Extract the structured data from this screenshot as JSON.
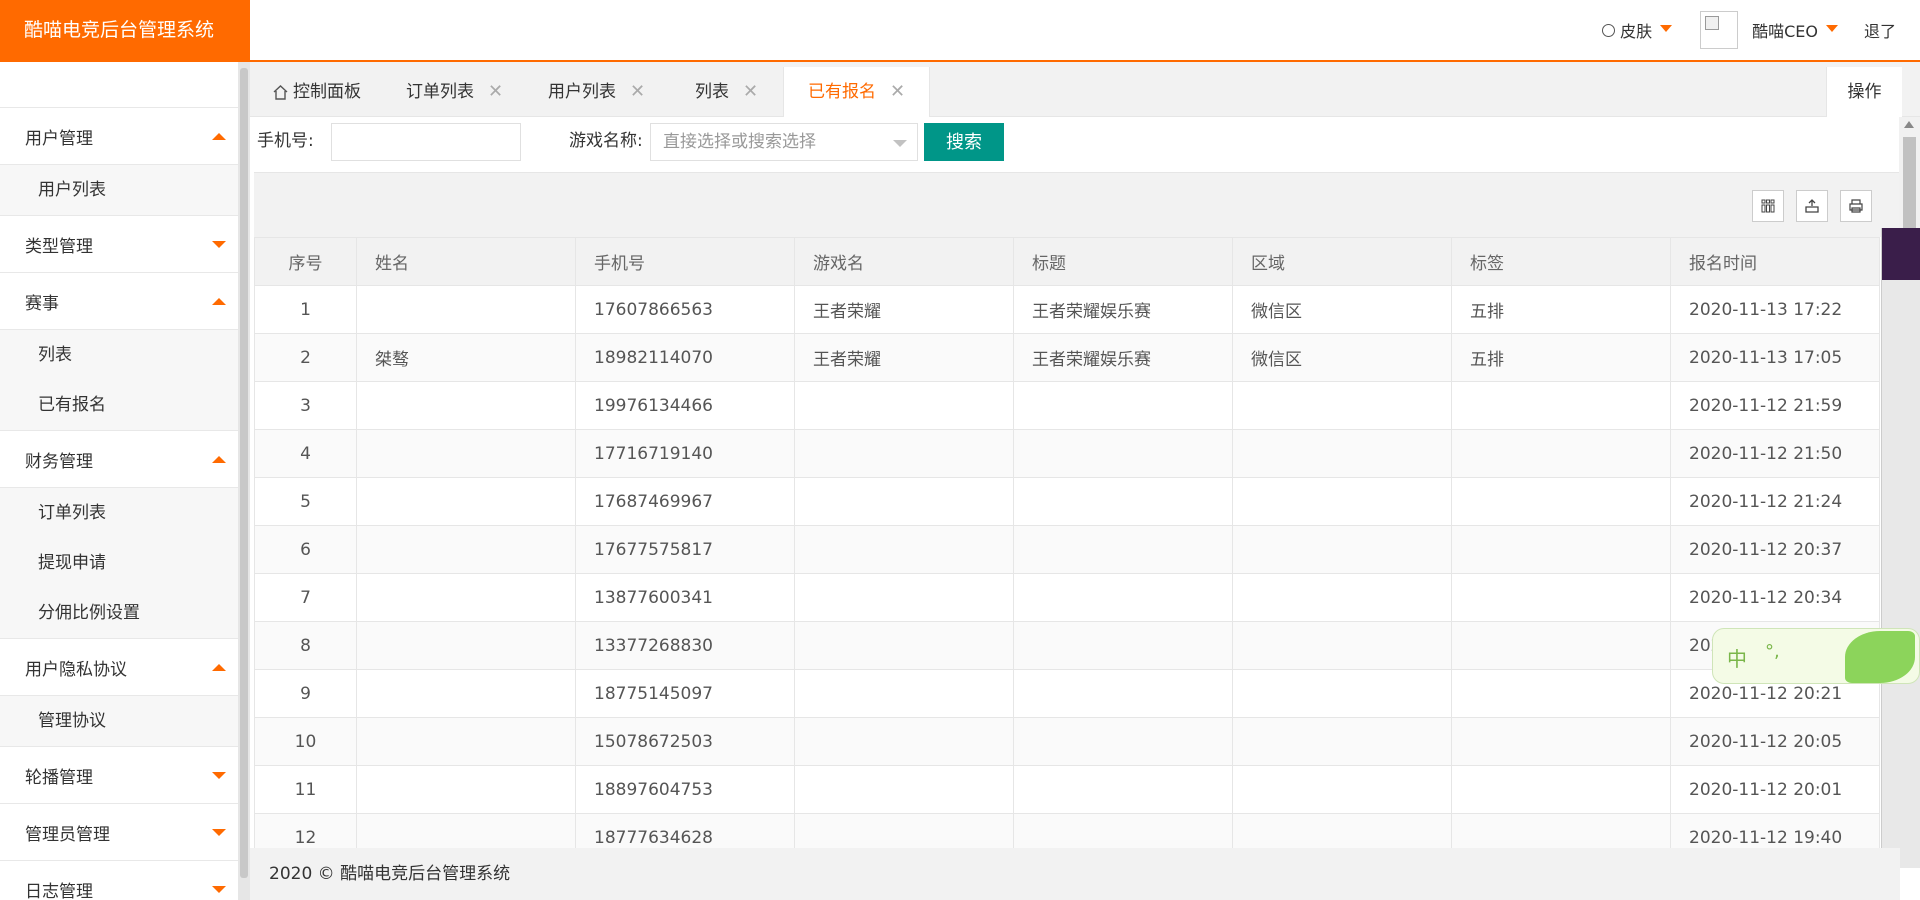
{
  "header": {
    "logo": "酷喵电竞后台管理系统",
    "skin_label": "皮肤",
    "user_label": "酷喵CEO",
    "logout_label": "退了"
  },
  "sidebar": {
    "groups": [
      {
        "title": "用户管理",
        "expanded": true,
        "items": [
          "用户列表"
        ]
      },
      {
        "title": "类型管理",
        "expanded": false,
        "items": []
      },
      {
        "title": "赛事",
        "expanded": true,
        "items": [
          "列表",
          "已有报名"
        ]
      },
      {
        "title": "财务管理",
        "expanded": true,
        "items": [
          "订单列表",
          "提现申请",
          "分佣比例设置"
        ]
      },
      {
        "title": "用户隐私协议",
        "expanded": true,
        "items": [
          "管理协议"
        ]
      },
      {
        "title": "轮播管理",
        "expanded": false,
        "items": []
      },
      {
        "title": "管理员管理",
        "expanded": false,
        "items": []
      },
      {
        "title": "日志管理",
        "expanded": false,
        "items": []
      }
    ]
  },
  "tabs": {
    "home": "控制面板",
    "items": [
      "订单列表",
      "用户列表",
      "列表",
      "已有报名"
    ],
    "active": "已有报名",
    "ops_label": "操作"
  },
  "search": {
    "phone_label": "手机号:",
    "phone_value": "",
    "game_label": "游戏名称:",
    "game_placeholder": "直接选择或搜索选择",
    "search_button": "搜索"
  },
  "table": {
    "columns": [
      "序号",
      "姓名",
      "手机号",
      "游戏名",
      "标题",
      "区域",
      "标签",
      "报名时间"
    ],
    "rows": [
      [
        "1",
        "",
        "17607866563",
        "王者荣耀",
        "王者荣耀娱乐赛",
        "微信区",
        "五排",
        "2020-11-13 17:22"
      ],
      [
        "2",
        "桀骜",
        "18982114070",
        "王者荣耀",
        "王者荣耀娱乐赛",
        "微信区",
        "五排",
        "2020-11-13 17:05"
      ],
      [
        "3",
        "",
        "19976134466",
        "",
        "",
        "",
        "",
        "2020-11-12 21:59"
      ],
      [
        "4",
        "",
        "17716719140",
        "",
        "",
        "",
        "",
        "2020-11-12 21:50"
      ],
      [
        "5",
        "",
        "17687469967",
        "",
        "",
        "",
        "",
        "2020-11-12 21:24"
      ],
      [
        "6",
        "",
        "17677575817",
        "",
        "",
        "",
        "",
        "2020-11-12 20:37"
      ],
      [
        "7",
        "",
        "13877600341",
        "",
        "",
        "",
        "",
        "2020-11-12 20:34"
      ],
      [
        "8",
        "",
        "13377268830",
        "",
        "",
        "",
        "",
        "202"
      ],
      [
        "9",
        "",
        "18775145097",
        "",
        "",
        "",
        "",
        "2020-11-12 20:21"
      ],
      [
        "10",
        "",
        "15078672503",
        "",
        "",
        "",
        "",
        "2020-11-12 20:05"
      ],
      [
        "11",
        "",
        "18897604753",
        "",
        "",
        "",
        "",
        "2020-11-12 20:01"
      ],
      [
        "12",
        "",
        "18777634628",
        "",
        "",
        "",
        "",
        "2020-11-12 19:40"
      ]
    ]
  },
  "ime": {
    "char": "中",
    "punct": "°,"
  },
  "footer": {
    "text": "2020 © 酷喵电竞后台管理系统"
  },
  "colors": {
    "accent": "#ff6a00",
    "search_button": "#009688"
  }
}
